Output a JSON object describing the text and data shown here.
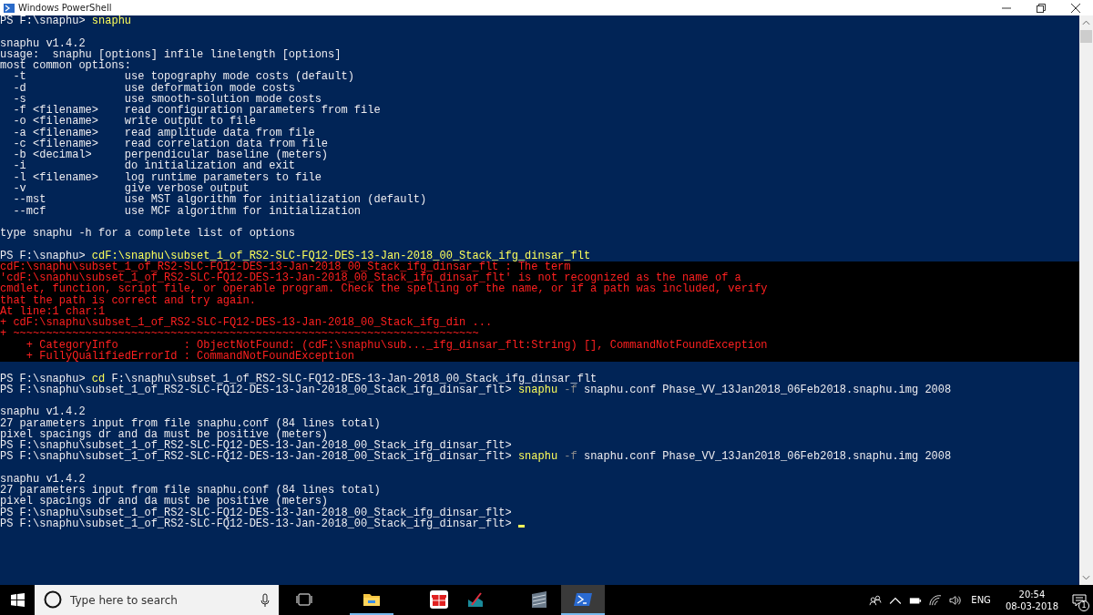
{
  "window": {
    "title": "Windows PowerShell"
  },
  "console": {
    "lines": [
      {
        "kind": "input",
        "segments": [
          {
            "kind": "plain",
            "text": "PS F:\\snaphu>"
          },
          {
            "kind": "command",
            "text": "snaphu"
          }
        ]
      },
      {
        "kind": "blank"
      },
      {
        "kind": "output",
        "text": "snaphu v1.4.2"
      },
      {
        "kind": "output",
        "text": "usage:  snaphu [options] infile linelength [options]"
      },
      {
        "kind": "output",
        "text": "most common options:"
      },
      {
        "kind": "output",
        "text": "  -t               use topography mode costs (default)"
      },
      {
        "kind": "output",
        "text": "  -d               use deformation mode costs"
      },
      {
        "kind": "output",
        "text": "  -s               use smooth-solution mode costs"
      },
      {
        "kind": "output",
        "text": "  -f <filename>    read configuration parameters from file"
      },
      {
        "kind": "output",
        "text": "  -o <filename>    write output to file"
      },
      {
        "kind": "output",
        "text": "  -a <filename>    read amplitude data from file"
      },
      {
        "kind": "output",
        "text": "  -c <filename>    read correlation data from file"
      },
      {
        "kind": "output",
        "text": "  -b <decimal>     perpendicular baseline (meters)"
      },
      {
        "kind": "output",
        "text": "  -i               do initialization and exit"
      },
      {
        "kind": "output",
        "text": "  -l <filename>    log runtime parameters to file"
      },
      {
        "kind": "output",
        "text": "  -v               give verbose output"
      },
      {
        "kind": "output",
        "text": "  --mst            use MST algorithm for initialization (default)"
      },
      {
        "kind": "output",
        "text": "  --mcf            use MCF algorithm for initialization"
      },
      {
        "kind": "blank"
      },
      {
        "kind": "output",
        "text": "type snaphu -h for a complete list of options"
      },
      {
        "kind": "blank"
      },
      {
        "kind": "input",
        "segments": [
          {
            "kind": "plain",
            "text": "PS F:\\snaphu>"
          },
          {
            "kind": "command",
            "text": "cdF:\\snaphu\\subset_1_of_RS2-SLC-FQ12-DES-13-Jan-2018_00_Stack_ifg_dinsar_flt"
          }
        ]
      },
      {
        "kind": "error",
        "text": "cdF:\\snaphu\\subset_1_of_RS2-SLC-FQ12-DES-13-Jan-2018_00_Stack_ifg_dinsar_flt : The term"
      },
      {
        "kind": "error",
        "text": "'cdF:\\snaphu\\subset_1_of_RS2-SLC-FQ12-DES-13-Jan-2018_00_Stack_ifg_dinsar_flt' is not recognized as the name of a"
      },
      {
        "kind": "error",
        "text": "cmdlet, function, script file, or operable program. Check the spelling of the name, or if a path was included, verify"
      },
      {
        "kind": "error",
        "text": "that the path is correct and try again."
      },
      {
        "kind": "error",
        "text": "At line:1 char:1"
      },
      {
        "kind": "error",
        "text": "+ cdF:\\snaphu\\subset_1_of_RS2-SLC-FQ12-DES-13-Jan-2018_00_Stack_ifg_din ..."
      },
      {
        "kind": "error",
        "text": "+ ~~~~~~~~~~~~~~~~~~~~~~~~~~~~~~~~~~~~~~~~~~~~~~~~~~~~~~~~~~~~~~~~~~~~~~~"
      },
      {
        "kind": "error",
        "text": "    + CategoryInfo          : ObjectNotFound: (cdF:\\snaphu\\sub..._ifg_dinsar_flt:String) [], CommandNotFoundException"
      },
      {
        "kind": "error",
        "text": "    + FullyQualifiedErrorId : CommandNotFoundException"
      },
      {
        "kind": "blank"
      },
      {
        "kind": "input",
        "segments": [
          {
            "kind": "plain",
            "text": "PS F:\\snaphu>"
          },
          {
            "kind": "command",
            "text": "cd"
          },
          {
            "kind": "plain",
            "text": "F:\\snaphu\\subset_1_of_RS2-SLC-FQ12-DES-13-Jan-2018_00_Stack_ifg_dinsar_flt"
          }
        ]
      },
      {
        "kind": "input",
        "segments": [
          {
            "kind": "plain",
            "text": "PS F:\\snaphu\\subset_1_of_RS2-SLC-FQ12-DES-13-Jan-2018_00_Stack_ifg_dinsar_flt>"
          },
          {
            "kind": "command",
            "text": "snaphu"
          },
          {
            "kind": "parameter",
            "text": "-f"
          },
          {
            "kind": "plain",
            "text": "snaphu.conf Phase_VV_13Jan2018_06Feb2018.snaphu.img 2008"
          }
        ]
      },
      {
        "kind": "blank"
      },
      {
        "kind": "output",
        "text": "snaphu v1.4.2"
      },
      {
        "kind": "output",
        "text": "27 parameters input from file snaphu.conf (84 lines total)"
      },
      {
        "kind": "output",
        "text": "pixel spacings dr and da must be positive (meters)"
      },
      {
        "kind": "input",
        "segments": [
          {
            "kind": "plain",
            "text": "PS F:\\snaphu\\subset_1_of_RS2-SLC-FQ12-DES-13-Jan-2018_00_Stack_ifg_dinsar_flt>"
          }
        ]
      },
      {
        "kind": "input",
        "segments": [
          {
            "kind": "plain",
            "text": "PS F:\\snaphu\\subset_1_of_RS2-SLC-FQ12-DES-13-Jan-2018_00_Stack_ifg_dinsar_flt>"
          },
          {
            "kind": "command",
            "text": "snaphu"
          },
          {
            "kind": "parameter",
            "text": "-f"
          },
          {
            "kind": "plain",
            "text": "snaphu.conf Phase_VV_13Jan2018_06Feb2018.snaphu.img 2008"
          }
        ]
      },
      {
        "kind": "blank"
      },
      {
        "kind": "output",
        "text": "snaphu v1.4.2"
      },
      {
        "kind": "output",
        "text": "27 parameters input from file snaphu.conf (84 lines total)"
      },
      {
        "kind": "output",
        "text": "pixel spacings dr and da must be positive (meters)"
      },
      {
        "kind": "input",
        "segments": [
          {
            "kind": "plain",
            "text": "PS F:\\snaphu\\subset_1_of_RS2-SLC-FQ12-DES-13-Jan-2018_00_Stack_ifg_dinsar_flt>"
          }
        ]
      },
      {
        "kind": "input",
        "cursor": true,
        "segments": [
          {
            "kind": "plain",
            "text": "PS F:\\snaphu\\subset_1_of_RS2-SLC-FQ12-DES-13-Jan-2018_00_Stack_ifg_dinsar_flt>"
          }
        ]
      }
    ]
  },
  "taskbar": {
    "search": {
      "placeholder": "Type here to search"
    },
    "apps": [
      {
        "kind": "explorer",
        "selected": false,
        "running": true
      },
      {
        "kind": "gift",
        "selected": false,
        "running": false
      },
      {
        "kind": "chart",
        "selected": false,
        "running": false
      },
      {
        "kind": "stripes",
        "selected": false,
        "running": false
      },
      {
        "kind": "powershell",
        "selected": true,
        "running": true
      }
    ],
    "tray": {
      "language": "ENG",
      "time": "20:54",
      "date": "08-03-2018",
      "notifications": "1"
    }
  }
}
